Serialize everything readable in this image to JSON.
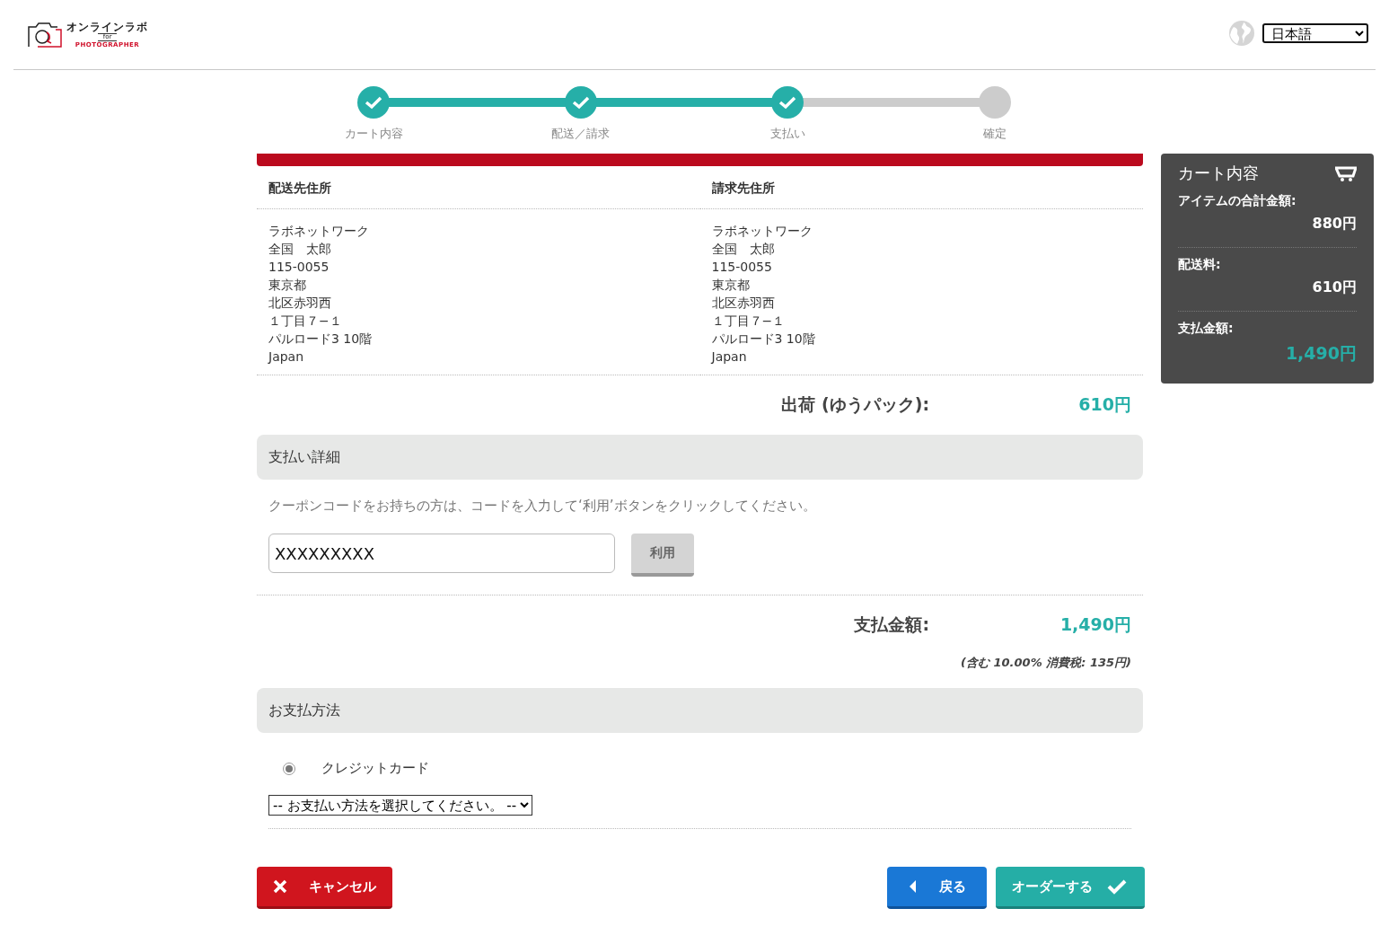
{
  "logo": {
    "title": "オンラインラボ",
    "for": "for",
    "subtitle": "PHOTOGRAPHER"
  },
  "language": {
    "value": "日本語"
  },
  "steps": [
    {
      "label": "カート内容",
      "done": true
    },
    {
      "label": "配送／請求",
      "done": true
    },
    {
      "label": "支払い",
      "done": true
    },
    {
      "label": "確定",
      "done": false
    }
  ],
  "addresses": [
    {
      "heading": "配送先住所",
      "lines": [
        "ラボネットワーク",
        "全国　太郎",
        "115-0055",
        "東京都",
        "北区赤羽西",
        "１丁目７−１",
        "パルロード3 10階",
        "Japan"
      ]
    },
    {
      "heading": "請求先住所",
      "lines": [
        "ラボネットワーク",
        "全国　太郎",
        "115-0055",
        "東京都",
        "北区赤羽西",
        "１丁目７−１",
        "パルロード3 10階",
        "Japan"
      ]
    }
  ],
  "shipping": {
    "label": "出荷 (ゆうパック):",
    "value": "610円"
  },
  "payment_details": {
    "heading": "支払い詳細",
    "coupon_hint": "クーポンコードをお持ちの方は、コードを入力して‘利用’ボタンをクリックしてください。",
    "coupon_value": "XXXXXXXXX",
    "apply_button": "利用"
  },
  "total": {
    "label": "支払金額:",
    "value": "1,490円",
    "tax_note": "(含む 10.00% 消費税: 135円)"
  },
  "payment_method": {
    "heading": "お支払方法",
    "options": [
      {
        "label": "クレジットカード",
        "selected": true
      }
    ],
    "select_value": "-- お支払い方法を選択してください。 --"
  },
  "buttons": {
    "cancel": "キャンセル",
    "back": "戻る",
    "order": "オーダーする"
  },
  "cart_summary": {
    "title": "カート内容",
    "rows": [
      {
        "label": "アイテムの合計金額:",
        "value": "880円",
        "kind": "normal"
      },
      {
        "label": "配送料:",
        "value": "610円",
        "kind": "normal"
      },
      {
        "label": "支払金額:",
        "value": "1,490円",
        "kind": "total"
      }
    ]
  }
}
